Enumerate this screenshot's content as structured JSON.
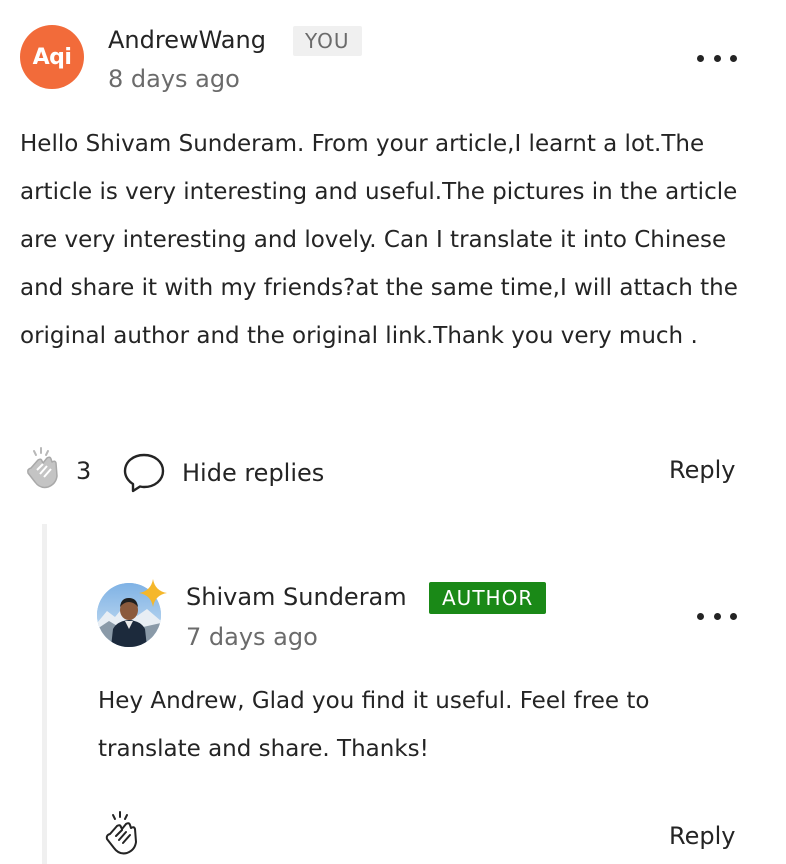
{
  "comment": {
    "avatar_text": "Aqi",
    "author": "AndrewWang",
    "badge": "YOU",
    "time": "8 days ago",
    "text": "Hello Shivam Sunderam. From your article,I learnt a lot.The article is very interesting and useful.The pictures in the article are very interesting and lovely. Can I translate it into Chinese and share it with my friends?at the same time,I will attach the original author and the original link.Thank you very much .",
    "claps": "3",
    "hide_replies_label": "Hide replies",
    "reply_label": "Reply",
    "more_icon": "more-horizontal-icon",
    "avatar_color": "#f26b3a"
  },
  "reply": {
    "author": "Shivam Sunderam",
    "badge": "AUTHOR",
    "time": "7 days ago",
    "text": "Hey Andrew, Glad you find it useful. Feel free to translate and share. Thanks!",
    "reply_label": "Reply",
    "more_icon": "more-horizontal-icon",
    "sparkle_icon": "sparkle-star-icon",
    "badge_color": "#1a8917"
  },
  "icons": {
    "clap": "clap-hands-icon",
    "response": "speech-bubble-icon"
  }
}
